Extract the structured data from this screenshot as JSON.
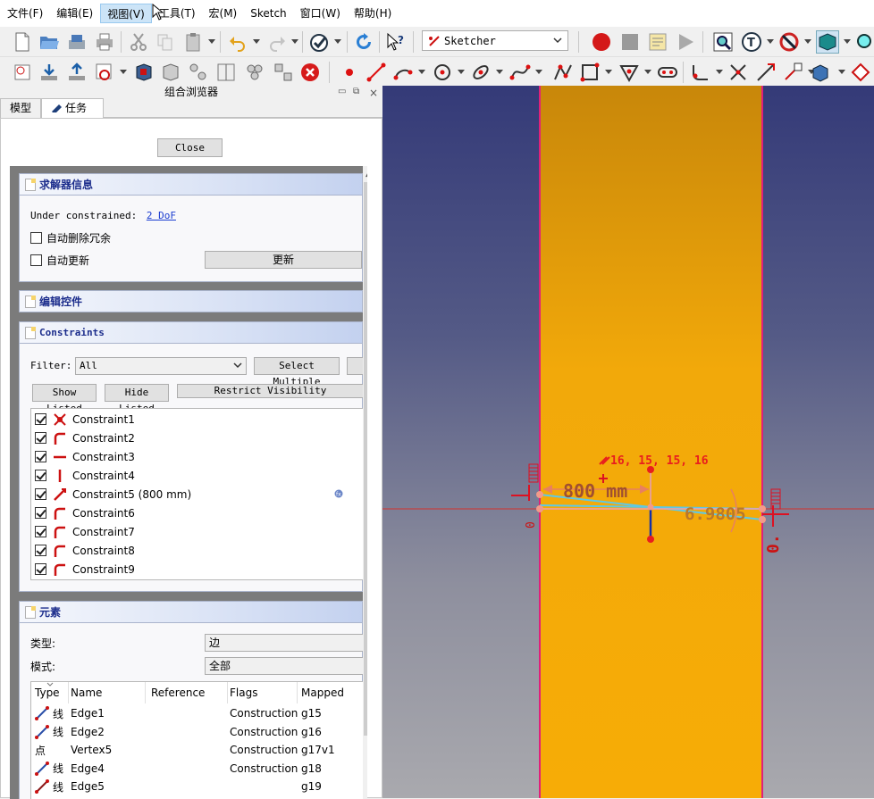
{
  "menu": [
    "文件(F)",
    "编辑(E)",
    "视图(V)",
    "工具(T)",
    "宏(M)",
    "Sketch",
    "窗口(W)",
    "帮助(H)"
  ],
  "workbench": "Sketcher",
  "panel": {
    "title": "组合浏览器",
    "tabs": [
      "模型",
      "任务"
    ],
    "close_label": "Close"
  },
  "solver": {
    "title": "求解器信息",
    "status": "Under constrained:",
    "dof": "2 DoF",
    "auto_remove": "自动删除冗余",
    "auto_update": "自动更新",
    "update_button": "更新"
  },
  "edit_controls": {
    "title": "编辑控件"
  },
  "constraints": {
    "title": "Constraints",
    "filter_label": "Filter:",
    "filter_value": "All",
    "select_multiple": "Select Multiple",
    "show_listed": "Show Listed",
    "hide_listed": "Hide Listed",
    "restrict_visibility": "Restrict Visibility",
    "items": [
      {
        "name": "Constraint1",
        "icon": "coincident"
      },
      {
        "name": "Constraint2",
        "icon": "tangent"
      },
      {
        "name": "Constraint3",
        "icon": "horizontal"
      },
      {
        "name": "Constraint4",
        "icon": "vertical"
      },
      {
        "name": "Constraint5 (800 mm)",
        "icon": "distance"
      },
      {
        "name": "Constraint6",
        "icon": "tangent"
      },
      {
        "name": "Constraint7",
        "icon": "tangent"
      },
      {
        "name": "Constraint8",
        "icon": "tangent"
      },
      {
        "name": "Constraint9",
        "icon": "tangent"
      }
    ]
  },
  "elements": {
    "title": "元素",
    "type_label": "类型:",
    "type_value": "边",
    "mode_label": "模式:",
    "mode_value": "全部",
    "columns": [
      "Type",
      "Name",
      "Reference",
      "Flags",
      "Mapped"
    ],
    "rows": [
      {
        "type": "线",
        "name": "Edge1",
        "reference": "",
        "flags": "Construction",
        "mapped": "g15",
        "icon": "line"
      },
      {
        "type": "线",
        "name": "Edge2",
        "reference": "",
        "flags": "Construction",
        "mapped": "g16",
        "icon": "line"
      },
      {
        "type": "点",
        "name": "Vertex5",
        "reference": "",
        "flags": "Construction",
        "mapped": "g17v1",
        "icon": ""
      },
      {
        "type": "线",
        "name": "Edge4",
        "reference": "",
        "flags": "Construction",
        "mapped": "g18",
        "icon": "line"
      },
      {
        "type": "线",
        "name": "Edge5",
        "reference": "",
        "flags": "",
        "mapped": "g19",
        "icon": "line"
      }
    ]
  },
  "viewport": {
    "label_tangent": "16, 15, 15, 16",
    "label_distance": "800 mm",
    "label_angle": "6.9805",
    "label_small": "0."
  },
  "colors": {
    "accent": "#1c2d8c",
    "sketch_red": "#e00000",
    "band": "#f2a90a",
    "construction": "#5fc8e6"
  }
}
